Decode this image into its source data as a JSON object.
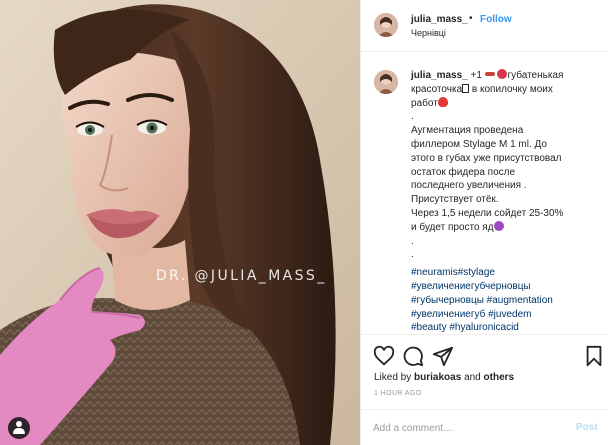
{
  "photo": {
    "watermark": "DR. @JULIA_MASS_",
    "alt_subject": "portrait photo"
  },
  "header": {
    "username": "julia_mass_",
    "separator": "•",
    "follow_label": "Follow",
    "location": "Чернівці"
  },
  "caption": {
    "username": "julia_mass_",
    "line1": "+1",
    "line1_rest": "губатенькая",
    "line2_a": "красоточка",
    "line2_b": "в копилочку моих",
    "line3": "работ",
    "dot1": ".",
    "line4": "Аугментация проведена",
    "line5": "филлером Stylage M 1 ml. До",
    "line6": "этого в губах уже присутствовал",
    "line7": "остаток фидера после",
    "line8": "последнего увеличения .",
    "line9": "Присутствует отёк.",
    "line10": "Через 1,5 недели сойдет 25-30%",
    "line11": "и будет просто яд",
    "dot2": ".",
    "dot3": ".",
    "tags1": "#neuramis#stylage",
    "tags2": "#увеличениегубчерновцы",
    "tags3": "#губычерновцы #augmentation",
    "tags4": "#увеличениегуб #juvedem",
    "tags5": "#beauty #hyaluronicacid"
  },
  "emoji_colors": {
    "syringe": "#c4443c",
    "lips": "#d9354a",
    "heart": "#e03b3b",
    "devil": "#9b4bc4"
  },
  "actions": {
    "icons": [
      "heart-icon",
      "comment-icon",
      "share-icon",
      "bookmark-icon"
    ],
    "liked_by_prefix": "Liked by",
    "liked_by_user": "buriakoas",
    "liked_by_and": "and",
    "liked_by_others": "others",
    "timestamp": "1 HOUR AGO"
  },
  "comment_box": {
    "placeholder": "Add a comment…",
    "post_label": "Post"
  },
  "colors": {
    "link_blue": "#3897f0",
    "hashtag": "#003569",
    "post_disabled": "#b2dffc"
  }
}
